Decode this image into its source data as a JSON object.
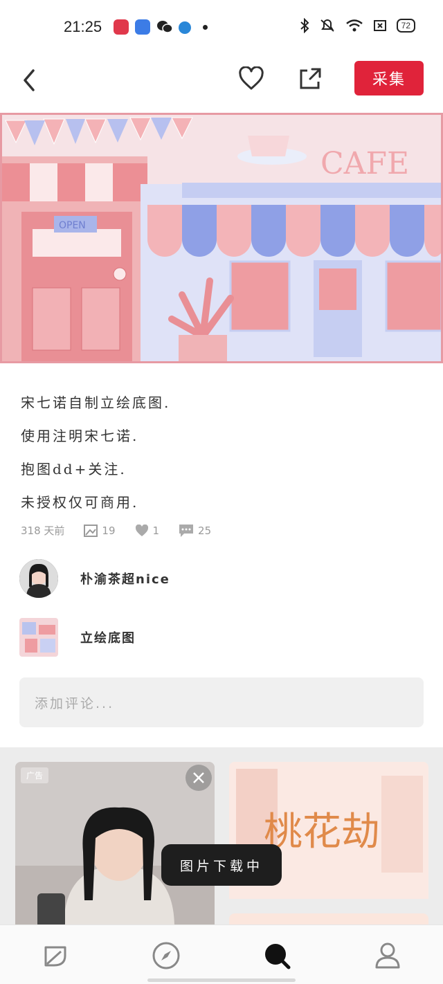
{
  "status_bar": {
    "time": "21:25",
    "battery": "72",
    "icons": [
      "bluetooth-icon",
      "mute-icon",
      "wifi-icon",
      "sim-icon",
      "battery-icon"
    ]
  },
  "top_nav": {
    "collect_label": "采集",
    "back_icon": "chevron-left-icon",
    "like_icon": "heart-outline-icon",
    "share_icon": "share-icon"
  },
  "hero_image": {
    "theme_colors": [
      "#f2a3a9",
      "#a9b5ea",
      "#fbe9ea"
    ],
    "text_on_image": [
      "OPEN",
      "CAFE"
    ]
  },
  "description": {
    "lines": [
      "宋七诺自制立绘底图.",
      "使用注明宋七诺.",
      "抱图dd+关注.",
      "未授权仅可商用."
    ]
  },
  "stats": {
    "time_ago": "318 天前",
    "saves": "19",
    "likes": "1",
    "comments": "25"
  },
  "author": {
    "name": "朴渝茶超nice"
  },
  "board": {
    "name": "立绘底图"
  },
  "comment_input": {
    "placeholder": "添加评论..."
  },
  "feed": {
    "ad_badge": "广告",
    "right_card_title": "桃花劫"
  },
  "toast": {
    "text": "图片下载中"
  },
  "tabbar": {
    "items": [
      "leaf-icon",
      "compass-icon",
      "search-icon",
      "profile-icon"
    ],
    "active_index": 2
  },
  "colors": {
    "accent": "#e0233a",
    "toast_bg": "#1e1e1e",
    "input_bg": "#f0f0f0"
  }
}
